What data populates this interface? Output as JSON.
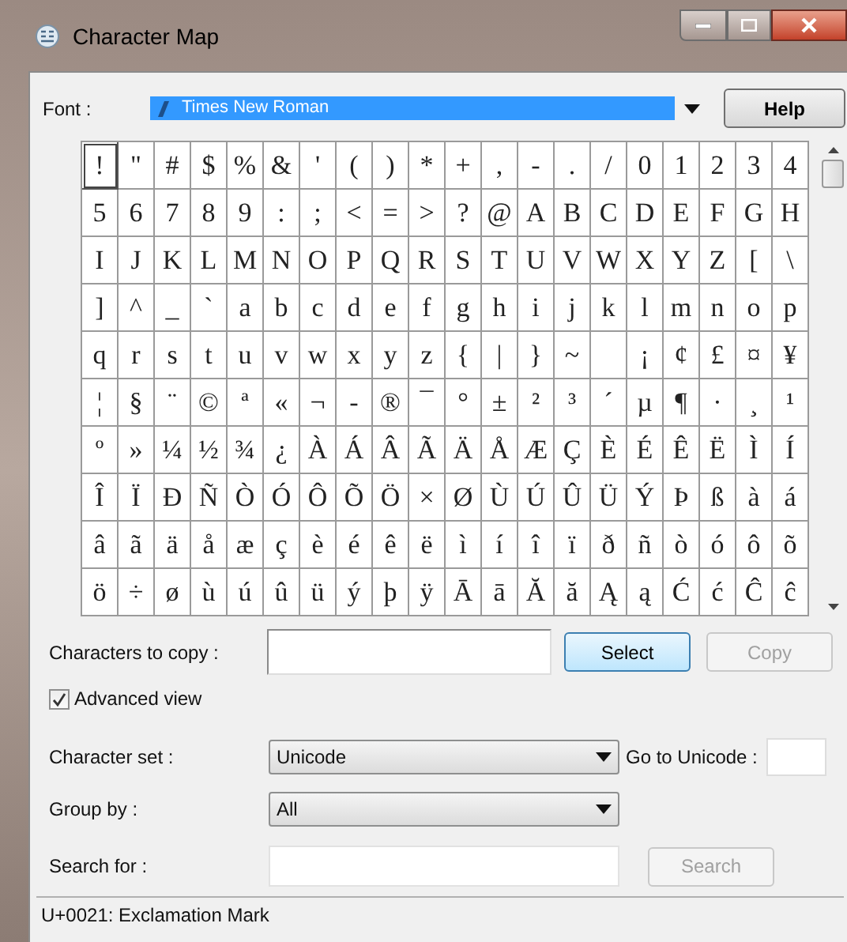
{
  "window": {
    "title": "Character Map"
  },
  "font": {
    "label": "Font :",
    "value": "Times New Roman",
    "help": "Help"
  },
  "grid": {
    "rows": [
      [
        {
          "char": "!",
          "selected": true
        },
        {
          "char": "\"",
          "selected": false
        },
        {
          "char": "#",
          "selected": false
        },
        {
          "char": "$",
          "selected": false
        },
        {
          "char": "%",
          "selected": false
        },
        {
          "char": "&",
          "selected": false
        },
        {
          "char": "'",
          "selected": false
        },
        {
          "char": "(",
          "selected": false
        },
        {
          "char": ")",
          "selected": false
        },
        {
          "char": "*",
          "selected": false
        },
        {
          "char": "+",
          "selected": false
        },
        {
          "char": ",",
          "selected": false
        },
        {
          "char": "-",
          "selected": false
        },
        {
          "char": ".",
          "selected": false
        },
        {
          "char": "/",
          "selected": false
        },
        {
          "char": "0",
          "selected": false
        },
        {
          "char": "1",
          "selected": false
        },
        {
          "char": "2",
          "selected": false
        },
        {
          "char": "3",
          "selected": false
        },
        {
          "char": "4",
          "selected": false
        }
      ],
      [
        {
          "char": "5",
          "selected": false
        },
        {
          "char": "6",
          "selected": false
        },
        {
          "char": "7",
          "selected": false
        },
        {
          "char": "8",
          "selected": false
        },
        {
          "char": "9",
          "selected": false
        },
        {
          "char": ":",
          "selected": false
        },
        {
          "char": ";",
          "selected": false
        },
        {
          "char": "<",
          "selected": false
        },
        {
          "char": "=",
          "selected": false
        },
        {
          "char": ">",
          "selected": false
        },
        {
          "char": "?",
          "selected": false
        },
        {
          "char": "@",
          "selected": false
        },
        {
          "char": "A",
          "selected": false
        },
        {
          "char": "B",
          "selected": false
        },
        {
          "char": "C",
          "selected": false
        },
        {
          "char": "D",
          "selected": false
        },
        {
          "char": "E",
          "selected": false
        },
        {
          "char": "F",
          "selected": false
        },
        {
          "char": "G",
          "selected": false
        },
        {
          "char": "H",
          "selected": false
        }
      ],
      [
        {
          "char": "I",
          "selected": false
        },
        {
          "char": "J",
          "selected": false
        },
        {
          "char": "K",
          "selected": false
        },
        {
          "char": "L",
          "selected": false
        },
        {
          "char": "M",
          "selected": false
        },
        {
          "char": "N",
          "selected": false
        },
        {
          "char": "O",
          "selected": false
        },
        {
          "char": "P",
          "selected": false
        },
        {
          "char": "Q",
          "selected": false
        },
        {
          "char": "R",
          "selected": false
        },
        {
          "char": "S",
          "selected": false
        },
        {
          "char": "T",
          "selected": false
        },
        {
          "char": "U",
          "selected": false
        },
        {
          "char": "V",
          "selected": false
        },
        {
          "char": "W",
          "selected": false
        },
        {
          "char": "X",
          "selected": false
        },
        {
          "char": "Y",
          "selected": false
        },
        {
          "char": "Z",
          "selected": false
        },
        {
          "char": "[",
          "selected": false
        },
        {
          "char": "\\",
          "selected": false
        }
      ],
      [
        {
          "char": "]",
          "selected": false
        },
        {
          "char": "^",
          "selected": false
        },
        {
          "char": "_",
          "selected": false
        },
        {
          "char": "`",
          "selected": false
        },
        {
          "char": "a",
          "selected": false
        },
        {
          "char": "b",
          "selected": false
        },
        {
          "char": "c",
          "selected": false
        },
        {
          "char": "d",
          "selected": false
        },
        {
          "char": "e",
          "selected": false
        },
        {
          "char": "f",
          "selected": false
        },
        {
          "char": "g",
          "selected": false
        },
        {
          "char": "h",
          "selected": false
        },
        {
          "char": "i",
          "selected": false
        },
        {
          "char": "j",
          "selected": false
        },
        {
          "char": "k",
          "selected": false
        },
        {
          "char": "l",
          "selected": false
        },
        {
          "char": "m",
          "selected": false
        },
        {
          "char": "n",
          "selected": false
        },
        {
          "char": "o",
          "selected": false
        },
        {
          "char": "p",
          "selected": false
        }
      ],
      [
        {
          "char": "q",
          "selected": false
        },
        {
          "char": "r",
          "selected": false
        },
        {
          "char": "s",
          "selected": false
        },
        {
          "char": "t",
          "selected": false
        },
        {
          "char": "u",
          "selected": false
        },
        {
          "char": "v",
          "selected": false
        },
        {
          "char": "w",
          "selected": false
        },
        {
          "char": "x",
          "selected": false
        },
        {
          "char": "y",
          "selected": false
        },
        {
          "char": "z",
          "selected": false
        },
        {
          "char": "{",
          "selected": false
        },
        {
          "char": "|",
          "selected": false
        },
        {
          "char": "}",
          "selected": false
        },
        {
          "char": "~",
          "selected": false
        },
        {
          "selected": false
        },
        {
          "char": "¡",
          "selected": false
        },
        {
          "char": "¢",
          "selected": false
        },
        {
          "char": "£",
          "selected": false
        },
        {
          "char": "¤",
          "selected": false
        },
        {
          "char": "¥",
          "selected": false
        }
      ],
      [
        {
          "char": "¦",
          "selected": false
        },
        {
          "char": "§",
          "selected": false
        },
        {
          "char": "¨",
          "selected": false
        },
        {
          "char": "©",
          "selected": false
        },
        {
          "char": "ª",
          "selected": false
        },
        {
          "char": "«",
          "selected": false
        },
        {
          "char": "¬",
          "selected": false
        },
        {
          "char": "-",
          "selected": false
        },
        {
          "char": "®",
          "selected": false
        },
        {
          "char": "¯",
          "selected": false
        },
        {
          "char": "°",
          "selected": false
        },
        {
          "char": "±",
          "selected": false
        },
        {
          "char": "²",
          "selected": false
        },
        {
          "char": "³",
          "selected": false
        },
        {
          "char": "´",
          "selected": false
        },
        {
          "char": "µ",
          "selected": false
        },
        {
          "char": "¶",
          "selected": false
        },
        {
          "char": "·",
          "selected": false
        },
        {
          "char": "¸",
          "selected": false
        },
        {
          "char": "¹",
          "selected": false
        }
      ],
      [
        {
          "char": "º",
          "selected": false
        },
        {
          "char": "»",
          "selected": false
        },
        {
          "char": "¼",
          "selected": false
        },
        {
          "char": "½",
          "selected": false
        },
        {
          "char": "¾",
          "selected": false
        },
        {
          "char": "¿",
          "selected": false
        },
        {
          "char": "À",
          "selected": false
        },
        {
          "char": "Á",
          "selected": false
        },
        {
          "char": "Â",
          "selected": false
        },
        {
          "char": "Ã",
          "selected": false
        },
        {
          "char": "Ä",
          "selected": false
        },
        {
          "char": "Å",
          "selected": false
        },
        {
          "char": "Æ",
          "selected": false
        },
        {
          "char": "Ç",
          "selected": false
        },
        {
          "char": "È",
          "selected": false
        },
        {
          "char": "É",
          "selected": false
        },
        {
          "char": "Ê",
          "selected": false
        },
        {
          "char": "Ë",
          "selected": false
        },
        {
          "char": "Ì",
          "selected": false
        },
        {
          "char": "Í",
          "selected": false
        }
      ],
      [
        {
          "char": "Î",
          "selected": false
        },
        {
          "char": "Ï",
          "selected": false
        },
        {
          "char": "Ð",
          "selected": false
        },
        {
          "char": "Ñ",
          "selected": false
        },
        {
          "char": "Ò",
          "selected": false
        },
        {
          "char": "Ó",
          "selected": false
        },
        {
          "char": "Ô",
          "selected": false
        },
        {
          "char": "Õ",
          "selected": false
        },
        {
          "char": "Ö",
          "selected": false
        },
        {
          "char": "×",
          "selected": false
        },
        {
          "char": "Ø",
          "selected": false
        },
        {
          "char": "Ù",
          "selected": false
        },
        {
          "char": "Ú",
          "selected": false
        },
        {
          "char": "Û",
          "selected": false
        },
        {
          "char": "Ü",
          "selected": false
        },
        {
          "char": "Ý",
          "selected": false
        },
        {
          "char": "Þ",
          "selected": false
        },
        {
          "char": "ß",
          "selected": false
        },
        {
          "char": "à",
          "selected": false
        },
        {
          "char": "á",
          "selected": false
        }
      ],
      [
        {
          "char": "â",
          "selected": false
        },
        {
          "char": "ã",
          "selected": false
        },
        {
          "char": "ä",
          "selected": false
        },
        {
          "char": "å",
          "selected": false
        },
        {
          "char": "æ",
          "selected": false
        },
        {
          "char": "ç",
          "selected": false
        },
        {
          "char": "è",
          "selected": false
        },
        {
          "char": "é",
          "selected": false
        },
        {
          "char": "ê",
          "selected": false
        },
        {
          "char": "ë",
          "selected": false
        },
        {
          "char": "ì",
          "selected": false
        },
        {
          "char": "í",
          "selected": false
        },
        {
          "char": "î",
          "selected": false
        },
        {
          "char": "ï",
          "selected": false
        },
        {
          "char": "ð",
          "selected": false
        },
        {
          "char": "ñ",
          "selected": false
        },
        {
          "char": "ò",
          "selected": false
        },
        {
          "char": "ó",
          "selected": false
        },
        {
          "char": "ô",
          "selected": false
        },
        {
          "char": "õ",
          "selected": false
        }
      ],
      [
        {
          "char": "ö",
          "selected": false
        },
        {
          "char": "÷",
          "selected": false
        },
        {
          "char": "ø",
          "selected": false
        },
        {
          "char": "ù",
          "selected": false
        },
        {
          "char": "ú",
          "selected": false
        },
        {
          "char": "û",
          "selected": false
        },
        {
          "char": "ü",
          "selected": false
        },
        {
          "char": "ý",
          "selected": false
        },
        {
          "char": "þ",
          "selected": false
        },
        {
          "char": "ÿ",
          "selected": false
        },
        {
          "char": "Ā",
          "selected": false
        },
        {
          "char": "ā",
          "selected": false
        },
        {
          "char": "Ă",
          "selected": false
        },
        {
          "char": "ă",
          "selected": false
        },
        {
          "char": "Ą",
          "selected": false
        },
        {
          "char": "ą",
          "selected": false
        },
        {
          "char": "Ć",
          "selected": false
        },
        {
          "char": "ć",
          "selected": false
        },
        {
          "char": "Ĉ",
          "selected": false
        },
        {
          "char": "ĉ",
          "selected": false
        }
      ]
    ]
  },
  "copy": {
    "label": "Characters to copy :",
    "select": "Select",
    "copy": "Copy",
    "copy_disabled": true
  },
  "advanced": {
    "label": "Advanced view",
    "checked": true
  },
  "character_set": {
    "label": "Character set :",
    "value": "Unicode",
    "goto_label": "Go to Unicode :"
  },
  "group_by": {
    "label": "Group by :",
    "value": "All"
  },
  "search": {
    "label": "Search for :",
    "button": "Search",
    "button_disabled": true
  },
  "status_bar": "U+0021: Exclamation Mark"
}
